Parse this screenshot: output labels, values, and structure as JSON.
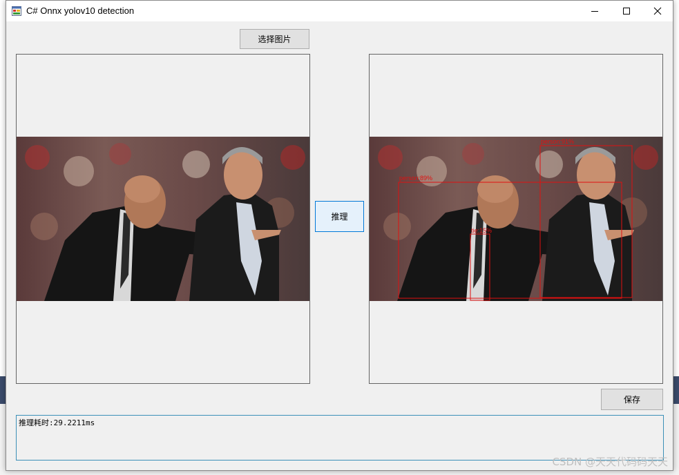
{
  "window": {
    "title": "C# Onnx yolov10 detection"
  },
  "buttons": {
    "select_image": "选择图片",
    "infer": "推理",
    "save": "保存"
  },
  "detections": [
    {
      "label": "person:91%"
    },
    {
      "label": "person:89%"
    },
    {
      "label": "tie:15%"
    }
  ],
  "output": {
    "text": "推理耗时:29.2211ms"
  },
  "watermark": "CSDN @天天代码码天天",
  "colors": {
    "detection_box": "#e01010",
    "output_border": "#3a8fb7",
    "focus_border": "#0078d7"
  },
  "icons": {
    "app": "app-form-icon",
    "minimize": "minimize-icon",
    "maximize": "maximize-icon",
    "close": "close-icon"
  }
}
